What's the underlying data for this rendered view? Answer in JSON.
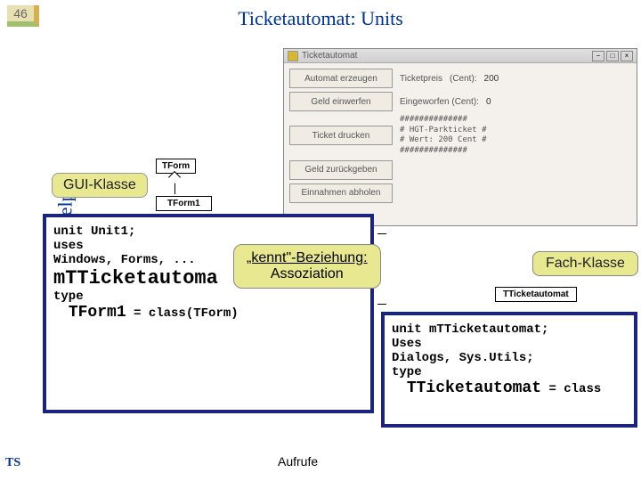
{
  "slide": {
    "number": "46",
    "title": "Ticketautomat: Units",
    "vertical": "OOP mit Delphi",
    "footer": "TS"
  },
  "window": {
    "title": "Ticketautomat",
    "buttons": {
      "erzeugen": "Automat erzeugen",
      "einwerfen": "Geld einwerfen",
      "drucken": "Ticket drucken",
      "zurueck": "Geld zurückgeben",
      "abholen": "Einnahmen abholen"
    },
    "labels": {
      "preis": "Ticketpreis",
      "cent": "(Cent):",
      "eingew": "Eingeworfen (Cent):"
    },
    "values": {
      "preis": "200",
      "eingew": "0"
    },
    "ticket": {
      "l1": "##############",
      "l2": "# HGT-Parkticket #",
      "l3": "# Wert: 200 Cent #",
      "l4": "##############"
    },
    "controls": {
      "min": "−",
      "max": "□",
      "close": "×"
    }
  },
  "uml": {
    "tform": "TForm",
    "tform1": "TForm1",
    "tticket": "TTicketautomat"
  },
  "labels": {
    "gui": "GUI-Klasse",
    "fach": "Fach-Klasse",
    "aufrufe": "Aufrufe"
  },
  "bubble": {
    "line1": "„kennt\"-Beziehung:",
    "line2": "Assoziation"
  },
  "code_left": {
    "l1": "unit Unit1;",
    "l2": "uses",
    "l3_pre": "  Windows, Forms, ...",
    "big": "mTTicketautoma",
    "l_type": "type",
    "tform1": "TForm1",
    "eq": " = class(TForm)"
  },
  "code_right": {
    "l1": "unit mTTicketautomat;",
    "l2": "Uses",
    "l3": "  Dialogs, Sys.Utils;",
    "l4": "type",
    "big": "TTicketautomat",
    "eq": " = class"
  }
}
